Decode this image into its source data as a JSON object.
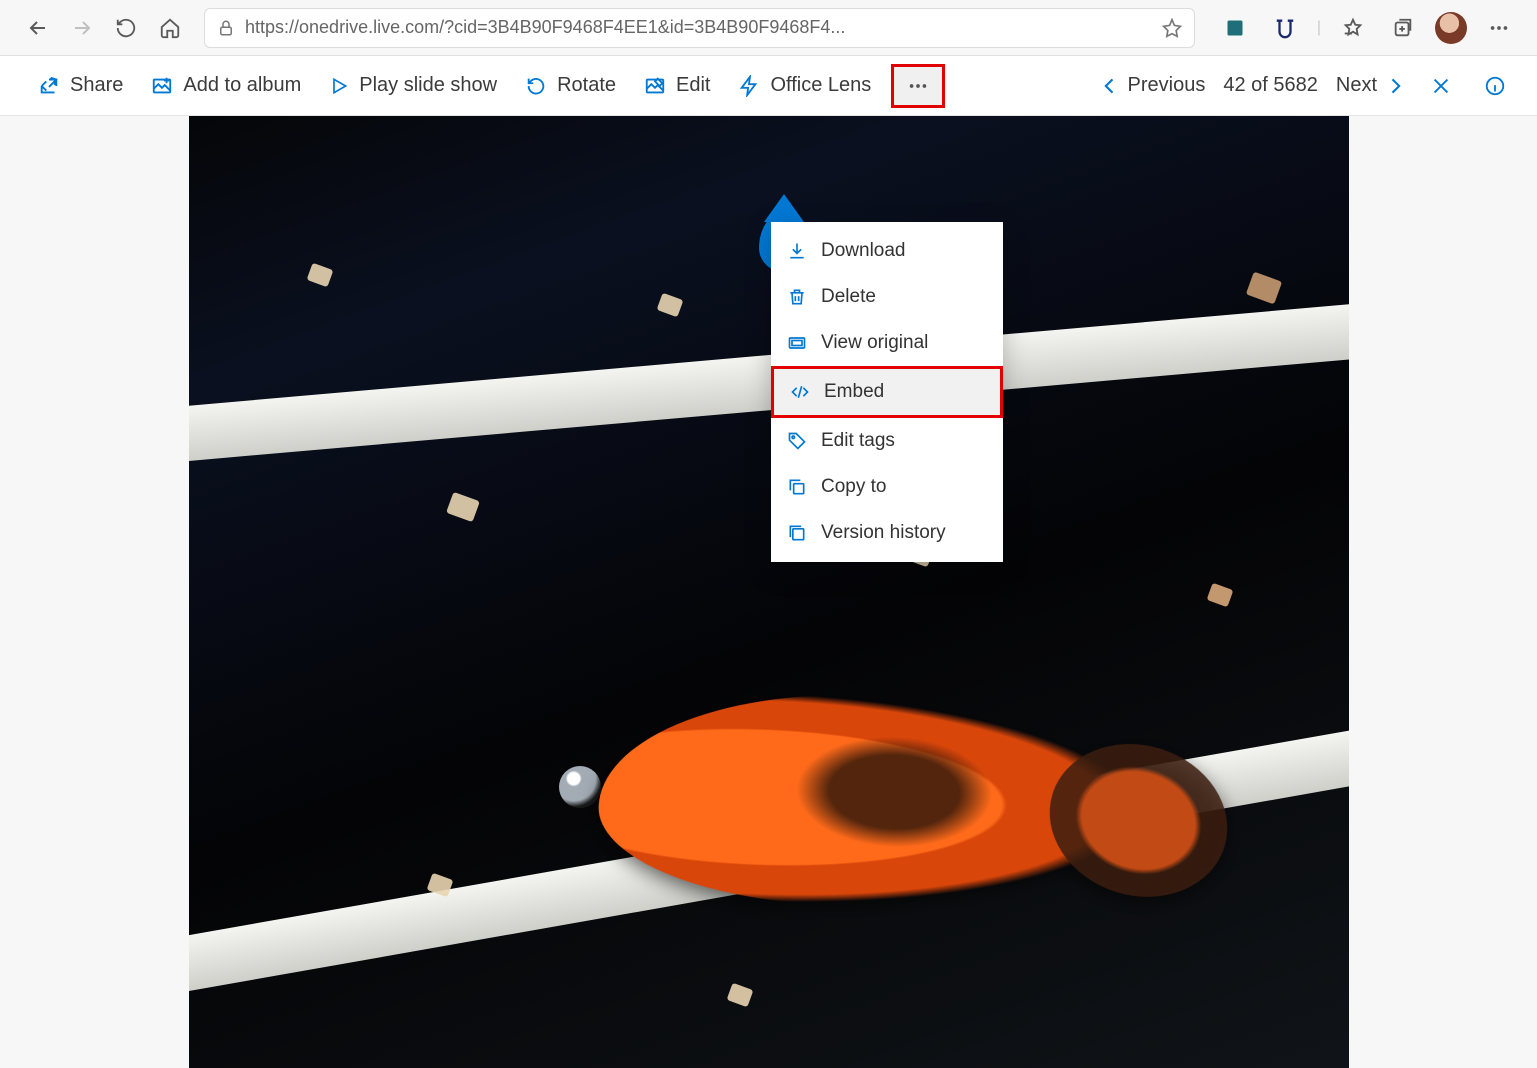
{
  "browser": {
    "url": "https://onedrive.live.com/?cid=3B4B90F9468F4EE1&id=3B4B90F9468F4..."
  },
  "toolbar": {
    "share": "Share",
    "add_to_album": "Add to album",
    "play_slideshow": "Play slide show",
    "rotate": "Rotate",
    "edit": "Edit",
    "office_lens": "Office Lens"
  },
  "nav": {
    "previous": "Previous",
    "counter": "42 of 5682",
    "next": "Next"
  },
  "menu": {
    "download": "Download",
    "delete": "Delete",
    "view_original": "View original",
    "embed": "Embed",
    "edit_tags": "Edit tags",
    "copy_to": "Copy to",
    "version_history": "Version history"
  }
}
